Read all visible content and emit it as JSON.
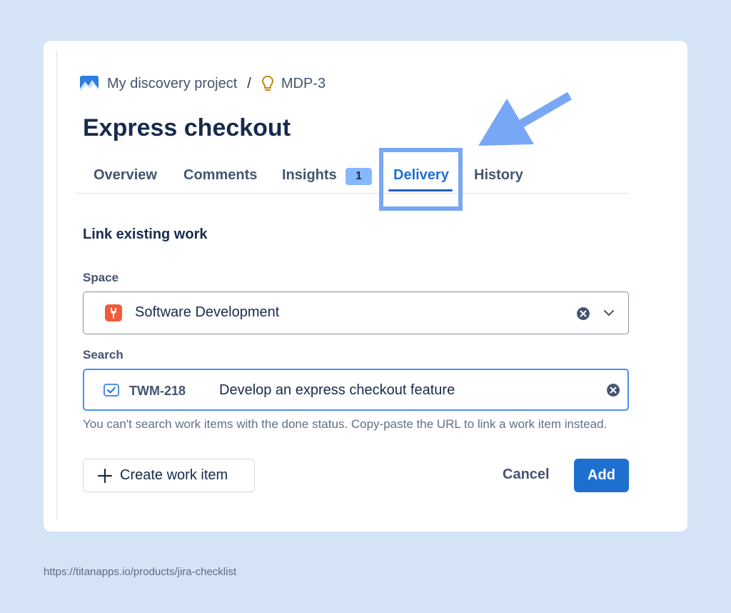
{
  "breadcrumb": {
    "project_name": "My discovery project",
    "separator": "/",
    "issue_key": "MDP-3"
  },
  "page_title": "Express checkout",
  "tabs": [
    {
      "label": "Overview"
    },
    {
      "label": "Comments"
    },
    {
      "label": "Insights",
      "badge": "1"
    },
    {
      "label": "Delivery",
      "active": true
    },
    {
      "label": "History"
    }
  ],
  "section_title": "Link existing work",
  "space_field": {
    "label": "Space",
    "value": "Software Development"
  },
  "search_field": {
    "label": "Search",
    "issue_key": "TWM-218",
    "issue_summary": "Develop an express checkout feature"
  },
  "hint_text": "You can't search work items with the done status. Copy-paste the URL to link a work item instead.",
  "buttons": {
    "create": "Create work item",
    "cancel": "Cancel",
    "add": "Add"
  },
  "footer_url": "https://titanapps.io/products/jira-checklist",
  "colors": {
    "background": "#d5e3f7",
    "accent": "#1f6fd1",
    "highlight": "#78a8f5",
    "badge": "#85b8ff"
  },
  "icons": [
    "project-icon",
    "lightbulb-icon",
    "space-icon",
    "clear-icon",
    "chevron-down-icon",
    "task-checkbox-icon",
    "plus-icon",
    "arrow-annotation"
  ]
}
